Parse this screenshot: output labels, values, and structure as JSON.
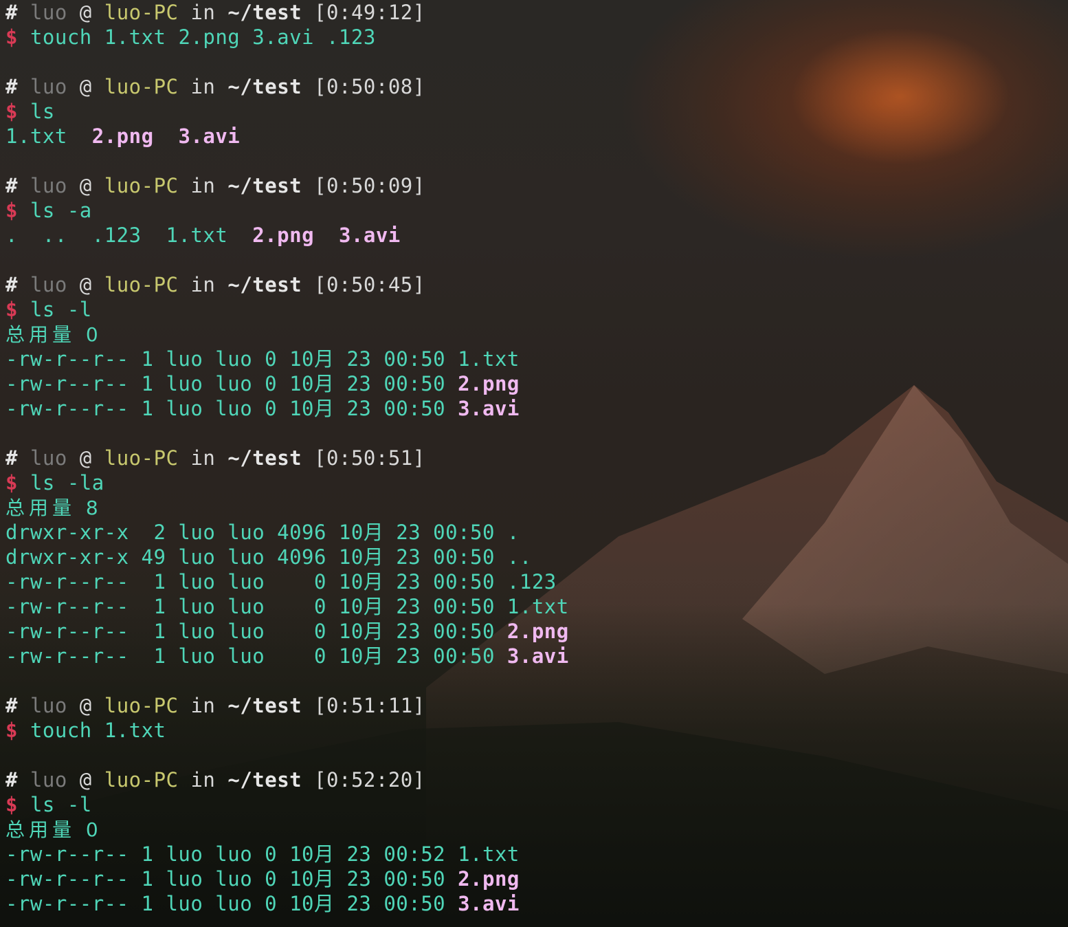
{
  "prompt_sep": "@",
  "prompt_in": "in",
  "sym_hash": "#",
  "sym_dollar": "$",
  "blocks": [
    {
      "user": "luo",
      "host": "luo-PC",
      "path": "~/test",
      "time": "[0:49:12]",
      "command": "touch 1.txt 2.png 3.avi .123"
    },
    {
      "user": "luo",
      "host": "luo-PC",
      "path": "~/test",
      "time": "[0:50:08]",
      "command": "ls",
      "output": {
        "f1": "1.txt",
        "f2": "2.png",
        "f3": "3.avi"
      }
    },
    {
      "user": "luo",
      "host": "luo-PC",
      "path": "~/test",
      "time": "[0:50:09]",
      "command": "ls -a",
      "output": {
        "d1": ".",
        "d2": "..",
        "h1": ".123",
        "f1": "1.txt",
        "f2": "2.png",
        "f3": "3.avi"
      }
    },
    {
      "user": "luo",
      "host": "luo-PC",
      "path": "~/test",
      "time": "[0:50:45]",
      "command": "ls -l",
      "total": "总用量 0",
      "rows": [
        {
          "meta": "-rw-r--r-- 1 luo luo 0 ",
          "date": "10月 23 00:50 ",
          "name": "1.txt"
        },
        {
          "meta": "-rw-r--r-- 1 luo luo 0 ",
          "date": "10月 23 00:50 ",
          "name": "2.png"
        },
        {
          "meta": "-rw-r--r-- 1 luo luo 0 ",
          "date": "10月 23 00:50 ",
          "name": "3.avi"
        }
      ]
    },
    {
      "user": "luo",
      "host": "luo-PC",
      "path": "~/test",
      "time": "[0:50:51]",
      "command": "ls -la",
      "total": "总用量 8",
      "rows": [
        {
          "meta": "drwxr-xr-x  2 luo luo 4096 ",
          "date": "10月 23 00:50 ",
          "name": "."
        },
        {
          "meta": "drwxr-xr-x 49 luo luo 4096 ",
          "date": "10月 23 00:50 ",
          "name": ".."
        },
        {
          "meta": "-rw-r--r--  1 luo luo    0 ",
          "date": "10月 23 00:50 ",
          "name": ".123"
        },
        {
          "meta": "-rw-r--r--  1 luo luo    0 ",
          "date": "10月 23 00:50 ",
          "name": "1.txt"
        },
        {
          "meta": "-rw-r--r--  1 luo luo    0 ",
          "date": "10月 23 00:50 ",
          "name": "2.png"
        },
        {
          "meta": "-rw-r--r--  1 luo luo    0 ",
          "date": "10月 23 00:50 ",
          "name": "3.avi"
        }
      ]
    },
    {
      "user": "luo",
      "host": "luo-PC",
      "path": "~/test",
      "time": "[0:51:11]",
      "command": "touch 1.txt"
    },
    {
      "user": "luo",
      "host": "luo-PC",
      "path": "~/test",
      "time": "[0:52:20]",
      "command": "ls -l",
      "total": "总用量 0",
      "rows": [
        {
          "meta": "-rw-r--r-- 1 luo luo 0 ",
          "date": "10月 23 00:52 ",
          "name": "1.txt"
        },
        {
          "meta": "-rw-r--r-- 1 luo luo 0 ",
          "date": "10月 23 00:50 ",
          "name": "2.png"
        },
        {
          "meta": "-rw-r--r-- 1 luo luo 0 ",
          "date": "10月 23 00:50 ",
          "name": "3.avi"
        }
      ]
    }
  ],
  "colors": {
    "highlight_box": "#e8294a",
    "command_text": "#4fd6b8",
    "media_file": "#f0b9f0",
    "dollar": "#d83a55",
    "host": "#c8c86e",
    "user": "#7b7b7b"
  }
}
